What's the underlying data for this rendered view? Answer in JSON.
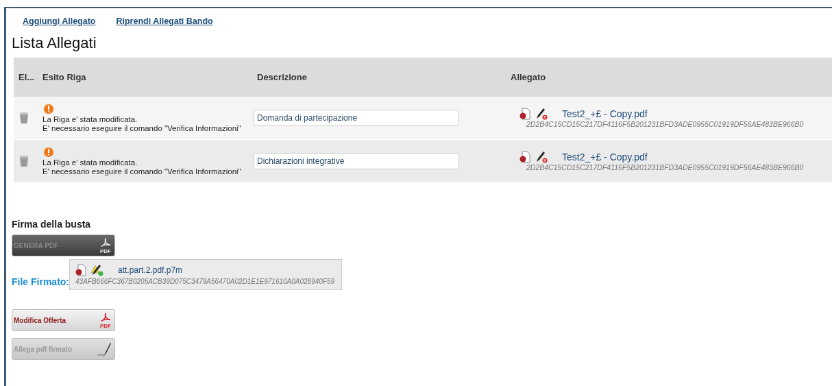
{
  "links": [
    {
      "label": "Aggiungi Allegato"
    },
    {
      "label": "Riprendi Allegati Bando"
    }
  ],
  "title": "Lista Allegati",
  "table": {
    "columns": [
      "El...",
      "Esito Riga",
      "Descrizione",
      "Allegato"
    ],
    "rows": [
      {
        "status_line1": "La Riga e' stata modificata.",
        "status_line2": "E' necessario eseguire il comando \"Verifica Informazioni\"",
        "description": "Domanda di partecipazione",
        "file_name": "Test2_+£ - Copy.pdf",
        "hash": "2D2B4C15CD15C217DF4116F5B201231BFD3ADE0955C01919DF56AE483BE966B0",
        "signature_valid": false
      },
      {
        "status_line1": "La Riga e' stata modificata.",
        "status_line2": "E' necessario eseguire il comando \"Verifica Informazioni\"",
        "description": "Dichiarazioni integrative",
        "file_name": "Test2_+£ - Copy.pdf",
        "hash": "2D2B4C15CD15C217DF4116F5B201231BFD3ADE0955C01919DF56AE483BE966B0",
        "signature_valid": false
      }
    ]
  },
  "signature_section": {
    "heading": "Firma della busta",
    "generate_button": {
      "label": "GENERA PDF",
      "icon_label": "PDF",
      "disabled": true
    },
    "signed_file_label": "File Firmato:",
    "signed_file": {
      "file_name": "att.part.2.pdf.p7m",
      "hash": "43AFB666FC367B0205ACB39D075C3479A56470A02D1E1E971610A0A028940F59",
      "signature_valid": true
    }
  },
  "action_buttons": [
    {
      "kind": "pdf",
      "label": "Modifica Offerta",
      "icon_label": "PDF",
      "disabled": false
    },
    {
      "kind": "sign",
      "label": "Allega pdf firmato",
      "disabled": true
    }
  ]
}
